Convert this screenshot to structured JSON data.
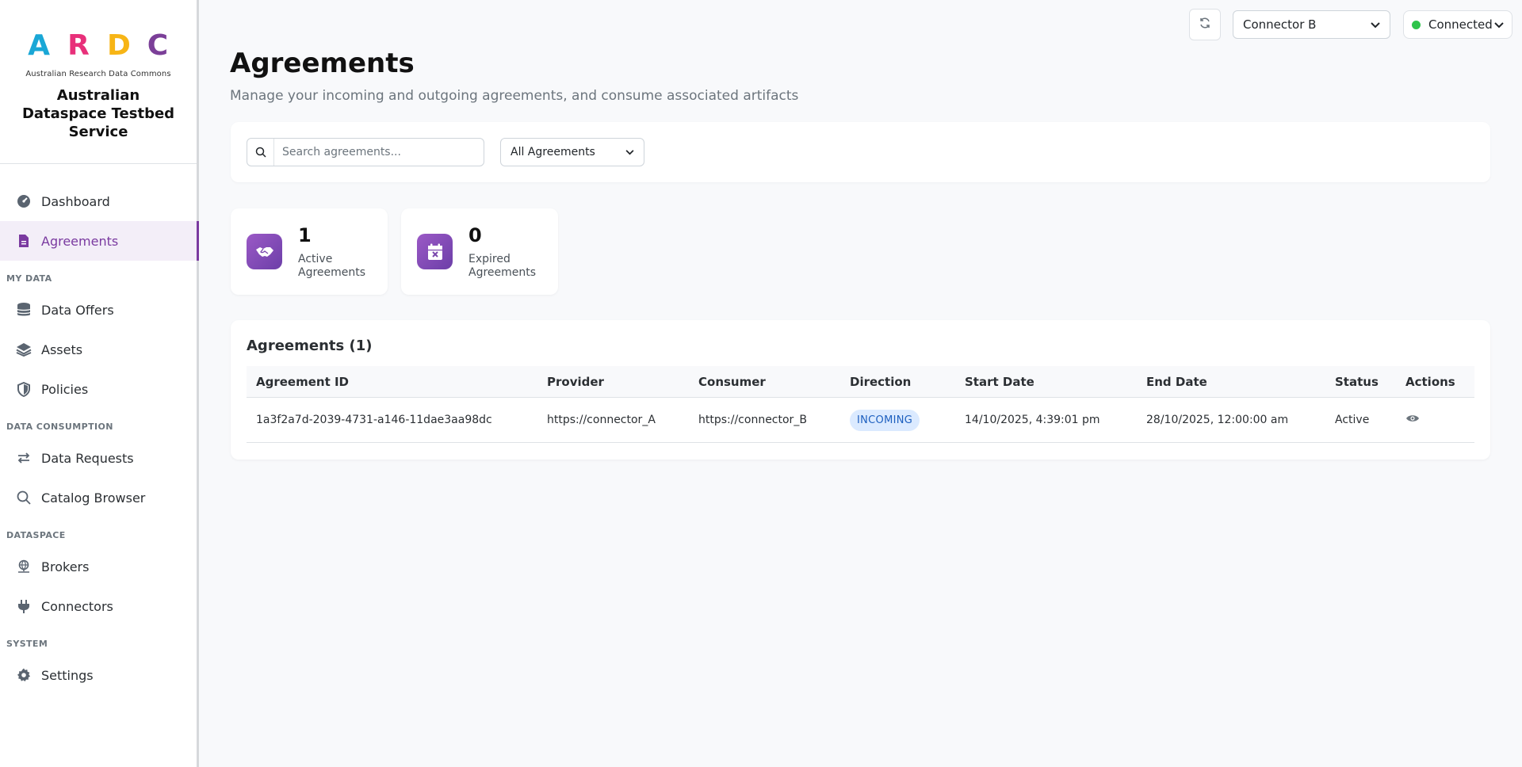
{
  "brand": {
    "logo_letters": [
      "A",
      "R",
      "D",
      "C"
    ],
    "logo_colors": [
      "#1aa7d6",
      "#e8307a",
      "#f7b516",
      "#7b3f98"
    ],
    "logo_subtitle": "Australian Research Data Commons",
    "title": "Australian Dataspace Testbed Service"
  },
  "sidebar": {
    "items_top": [
      {
        "label": "Dashboard",
        "icon": "gauge-icon"
      },
      {
        "label": "Agreements",
        "icon": "document-icon",
        "active": true
      }
    ],
    "sections": [
      {
        "title": "MY DATA",
        "items": [
          {
            "label": "Data Offers",
            "icon": "database-icon"
          },
          {
            "label": "Assets",
            "icon": "layers-icon"
          },
          {
            "label": "Policies",
            "icon": "shield-icon"
          }
        ]
      },
      {
        "title": "DATA CONSUMPTION",
        "items": [
          {
            "label": "Data Requests",
            "icon": "arrows-exchange-icon"
          },
          {
            "label": "Catalog Browser",
            "icon": "search-icon"
          }
        ]
      },
      {
        "title": "DATASPACE",
        "items": [
          {
            "label": "Brokers",
            "icon": "network-icon"
          },
          {
            "label": "Connectors",
            "icon": "plug-icon"
          }
        ]
      },
      {
        "title": "SYSTEM",
        "items": [
          {
            "label": "Settings",
            "icon": "gear-icon"
          }
        ]
      }
    ]
  },
  "topbar": {
    "connector_selected": "Connector B",
    "status_label": "Connected",
    "status_color": "#2ec44a"
  },
  "page": {
    "title": "Agreements",
    "subtitle": "Manage your incoming and outgoing agreements, and consume associated artifacts"
  },
  "filters": {
    "search_placeholder": "Search agreements...",
    "filter_selected": "All Agreements"
  },
  "stats": [
    {
      "value": "1",
      "label": "Active Agreements",
      "icon": "handshake-icon"
    },
    {
      "value": "0",
      "label": "Expired Agreements",
      "icon": "calendar-x-icon"
    }
  ],
  "table": {
    "title": "Agreements (1)",
    "columns": [
      "Agreement ID",
      "Provider",
      "Consumer",
      "Direction",
      "Start Date",
      "End Date",
      "Status",
      "Actions"
    ],
    "rows": [
      {
        "agreement_id": "1a3f2a7d-2039-4731-a146-11dae3aa98dc",
        "provider": "https://connector_A",
        "consumer": "https://connector_B",
        "direction": "INCOMING",
        "start_date": "14/10/2025, 4:39:01 pm",
        "end_date": "28/10/2025, 12:00:00 am",
        "status": "Active",
        "action_icon": "eye-icon"
      }
    ]
  }
}
